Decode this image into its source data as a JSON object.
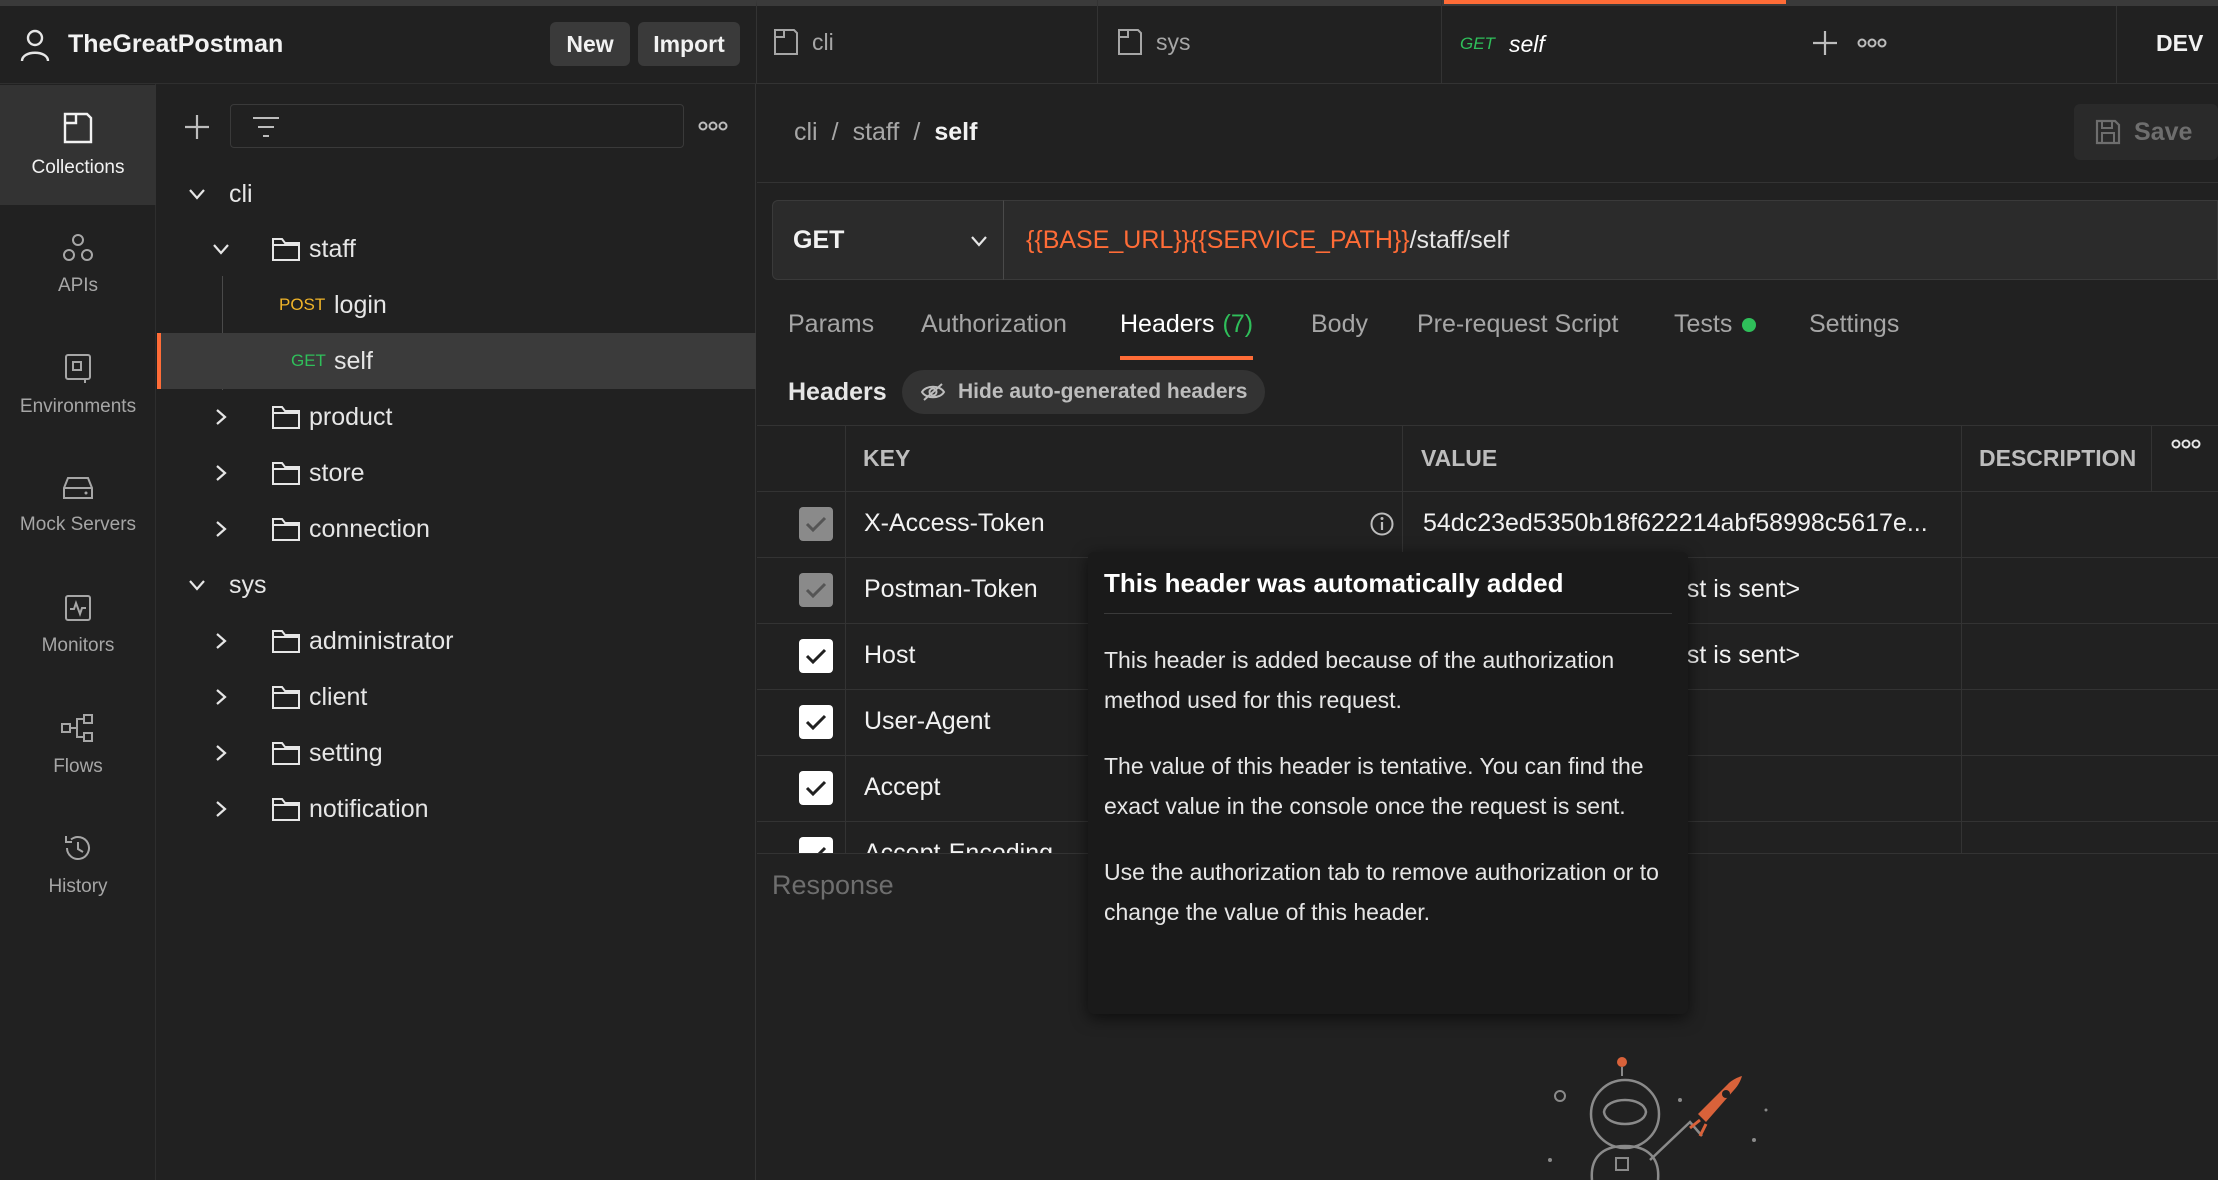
{
  "workspace": {
    "name": "TheGreatPostman",
    "new_label": "New",
    "import_label": "Import"
  },
  "tabs": [
    {
      "label": "cli"
    },
    {
      "label": "sys"
    },
    {
      "method": "GET",
      "label": "self"
    }
  ],
  "environment": {
    "label": "DEV"
  },
  "rail": {
    "collections": "Collections",
    "apis": "APIs",
    "environments": "Environments",
    "mock_servers": "Mock Servers",
    "monitors": "Monitors",
    "flows": "Flows",
    "history": "History"
  },
  "tree": {
    "cli": "cli",
    "staff": "staff",
    "login_method": "POST",
    "login": "login",
    "self_method": "GET",
    "self": "self",
    "product": "product",
    "store": "store",
    "connection": "connection",
    "sys": "sys",
    "administrator": "administrator",
    "client": "client",
    "setting": "setting",
    "notification": "notification"
  },
  "breadcrumb": {
    "a": "cli",
    "sep1": "/",
    "b": "staff",
    "sep2": "/",
    "c": "self"
  },
  "save_label": "Save",
  "request": {
    "method": "GET",
    "url_var1": "{{BASE_URL}}",
    "url_var2": "{{SERVICE_PATH}}",
    "url_path": "/staff/self"
  },
  "request_tabs": {
    "params": "Params",
    "authorization": "Authorization",
    "headers": "Headers",
    "headers_count": "(7)",
    "body": "Body",
    "pre_request": "Pre-request Script",
    "tests": "Tests",
    "settings": "Settings"
  },
  "headers_section": {
    "label": "Headers",
    "hide_auto": "Hide auto-generated headers"
  },
  "table": {
    "col_key": "KEY",
    "col_value": "VALUE",
    "col_description": "DESCRIPTION",
    "rows": [
      {
        "key": "X-Access-Token",
        "value": "54dc23ed5350b18f622214abf58998c5617e..."
      },
      {
        "key": "Postman-Token",
        "value": "est is sent>"
      },
      {
        "key": "Host",
        "value": "est is sent>"
      },
      {
        "key": "User-Agent",
        "value": ""
      },
      {
        "key": "Accept",
        "value": ""
      },
      {
        "key": "Accept-Encoding",
        "value": ""
      }
    ]
  },
  "response_label": "Response",
  "tooltip": {
    "title": "This header was automatically added",
    "p1": "This header is added because of the authorization method used for this request.",
    "p2": "The value of this header is tentative. You can find the exact value in the console once the request is sent.",
    "p3": "Use the authorization tab to remove authorization or to change the value of this header."
  },
  "colors": {
    "accent": "#ff6c37",
    "get": "#2fbf5a",
    "post": "#f0b429"
  },
  "icons": [
    "user-icon",
    "collections-icon",
    "apis-icon",
    "environments-icon",
    "mock-servers-icon",
    "monitors-icon",
    "flows-icon",
    "history-icon",
    "folder-icon",
    "chevron-down-icon",
    "chevron-right-icon",
    "plus-icon",
    "filter-icon",
    "more-icon",
    "save-icon",
    "info-icon",
    "eye-off-icon",
    "check-icon"
  ]
}
